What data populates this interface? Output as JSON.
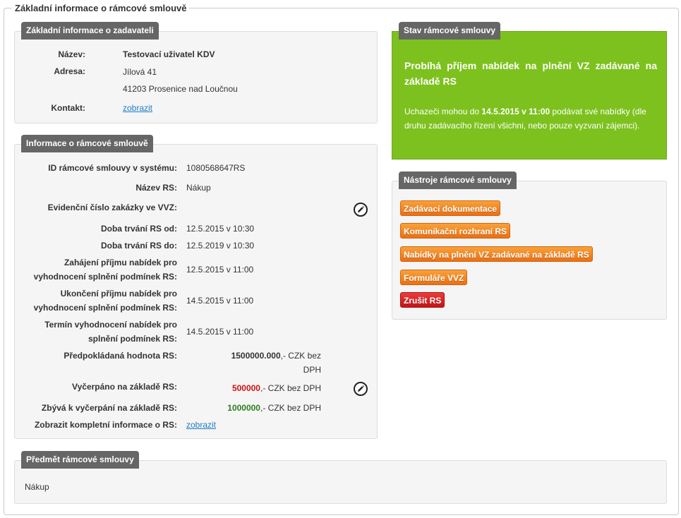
{
  "page": {
    "legend": "Základní informace o rámcové smlouvě"
  },
  "zadavatel": {
    "title": "Základní informace o zadavateli",
    "name_label": "Název:",
    "name_value": "Testovací uživatel KDV",
    "address_label": "Adresa:",
    "address_line1": "Jílová 41",
    "address_line2": "41203 Prosenice nad Loučnou",
    "contact_label": "Kontakt:",
    "contact_link": "zobrazit"
  },
  "rs_info": {
    "title": "Informace o rámcové smlouvě",
    "id_label": "ID rámcové smlouvy v systému:",
    "id_value": "1080568647RS",
    "name_label": "Název RS:",
    "name_value": "Nákup",
    "evid_label": "Evidenční číslo zakázky ve VVZ:",
    "from_label": "Doba trvání RS od:",
    "from_value": "12.5.2015 v 10:30",
    "to_label": "Doba trvání RS do:",
    "to_value": "12.5.2019 v 10:30",
    "start_label_1": "Zahájení příjmu nabídek pro",
    "start_label_2": "vyhodnocení splnění podmínek RS:",
    "start_value": "12.5.2015 v 11:00",
    "end_label_1": "Ukončení příjmu nabídek pro",
    "end_label_2": "vyhodnocení splnění podmínek RS:",
    "end_value": "14.5.2015 v 11:00",
    "eval_label_1": "Termín vyhodnocení nabídek pro",
    "eval_label_2": "splnění podmínek RS:",
    "eval_value": "14.5.2015 v 11:00",
    "expected_label": "Předpokládaná hodnota RS:",
    "expected_amount": "1500000.000",
    "expected_suffix_1": ",- CZK bez",
    "expected_suffix_2": "DPH",
    "used_label": "Vyčerpáno na základě RS:",
    "used_amount": "500000",
    "used_suffix": ",- CZK bez DPH",
    "remaining_label": "Zbývá k vyčerpání na základě RS:",
    "remaining_amount": "1000000",
    "remaining_suffix": ",- CZK bez DPH",
    "full_label": "Zobrazit kompletní informace o RS:",
    "full_link": "zobrazit"
  },
  "status": {
    "title": "Stav rámcové smlouvy",
    "heading": "Probíhá příjem nabídek na plnění VZ zadávané na základě RS",
    "text_prefix": "Uchazeči mohou do ",
    "text_deadline": "14.5.2015 v 11:00",
    "text_suffix": " podávat své nabídky (dle druhu zadávacího řízení všichni, nebo pouze vyzvaní zájemci).",
    "color": "#7dc11e"
  },
  "tools": {
    "title": "Nástroje rámcové smlouvy",
    "buttons": [
      "Zadávací dokumentace",
      "Komunikační rozhraní RS",
      "Nabídky na plnění VZ zadávané na základě RS",
      "Formuláře VVZ",
      "Zrušit RS"
    ],
    "accent_color": "#ec6f12",
    "danger_color": "#c41515"
  },
  "subject": {
    "title": "Předmět rámcové smlouvy",
    "text": "Nákup"
  }
}
